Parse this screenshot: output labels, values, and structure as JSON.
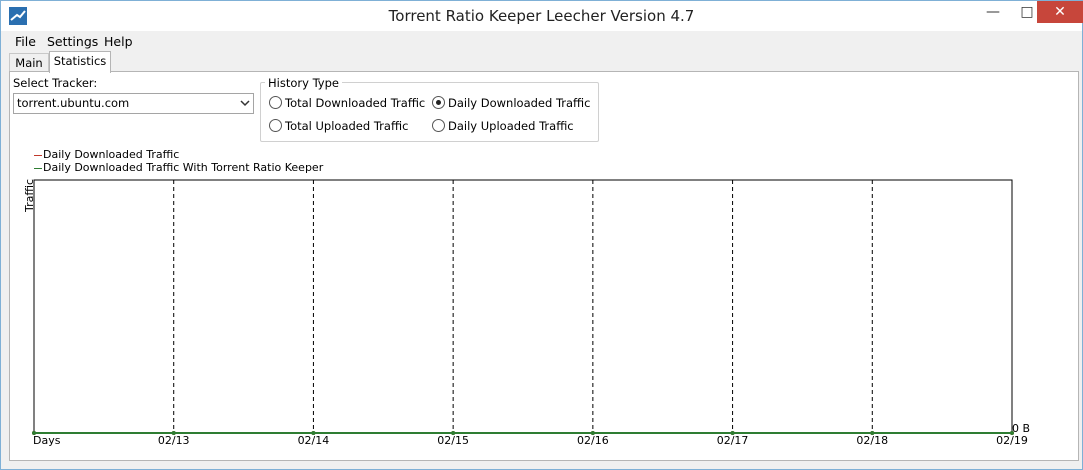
{
  "window": {
    "title": "Torrent Ratio Keeper Leecher Version 4.7"
  },
  "menu": {
    "items": [
      "File",
      "Settings",
      "Help"
    ]
  },
  "tabs": [
    "Main",
    "Statistics"
  ],
  "tracker": {
    "label": "Select Tracker:",
    "value": "torrent.ubuntu.com"
  },
  "history": {
    "title": "History Type",
    "options": [
      {
        "label": "Total Downloaded Traffic",
        "checked": false
      },
      {
        "label": "Daily Downloaded Traffic",
        "checked": true
      },
      {
        "label": "Total Uploaded Traffic",
        "checked": false
      },
      {
        "label": "Daily Uploaded Traffic",
        "checked": false
      }
    ]
  },
  "chart_data": {
    "type": "line",
    "ylabel": "Traffic",
    "xlabel": "Days",
    "x": [
      "02/13",
      "02/14",
      "02/15",
      "02/16",
      "02/17",
      "02/18",
      "02/19"
    ],
    "y_tick_label": "0 B",
    "grid": "vertical-dashed",
    "series": [
      {
        "name": "Daily Downloaded Traffic",
        "color": "#c0392b",
        "values": [
          0,
          0,
          0,
          0,
          0,
          0,
          0
        ]
      },
      {
        "name": "Daily Downloaded Traffic With Torrent Ratio Keeper",
        "color": "#2e7d32",
        "values": [
          0,
          0,
          0,
          0,
          0,
          0,
          0
        ]
      }
    ]
  }
}
